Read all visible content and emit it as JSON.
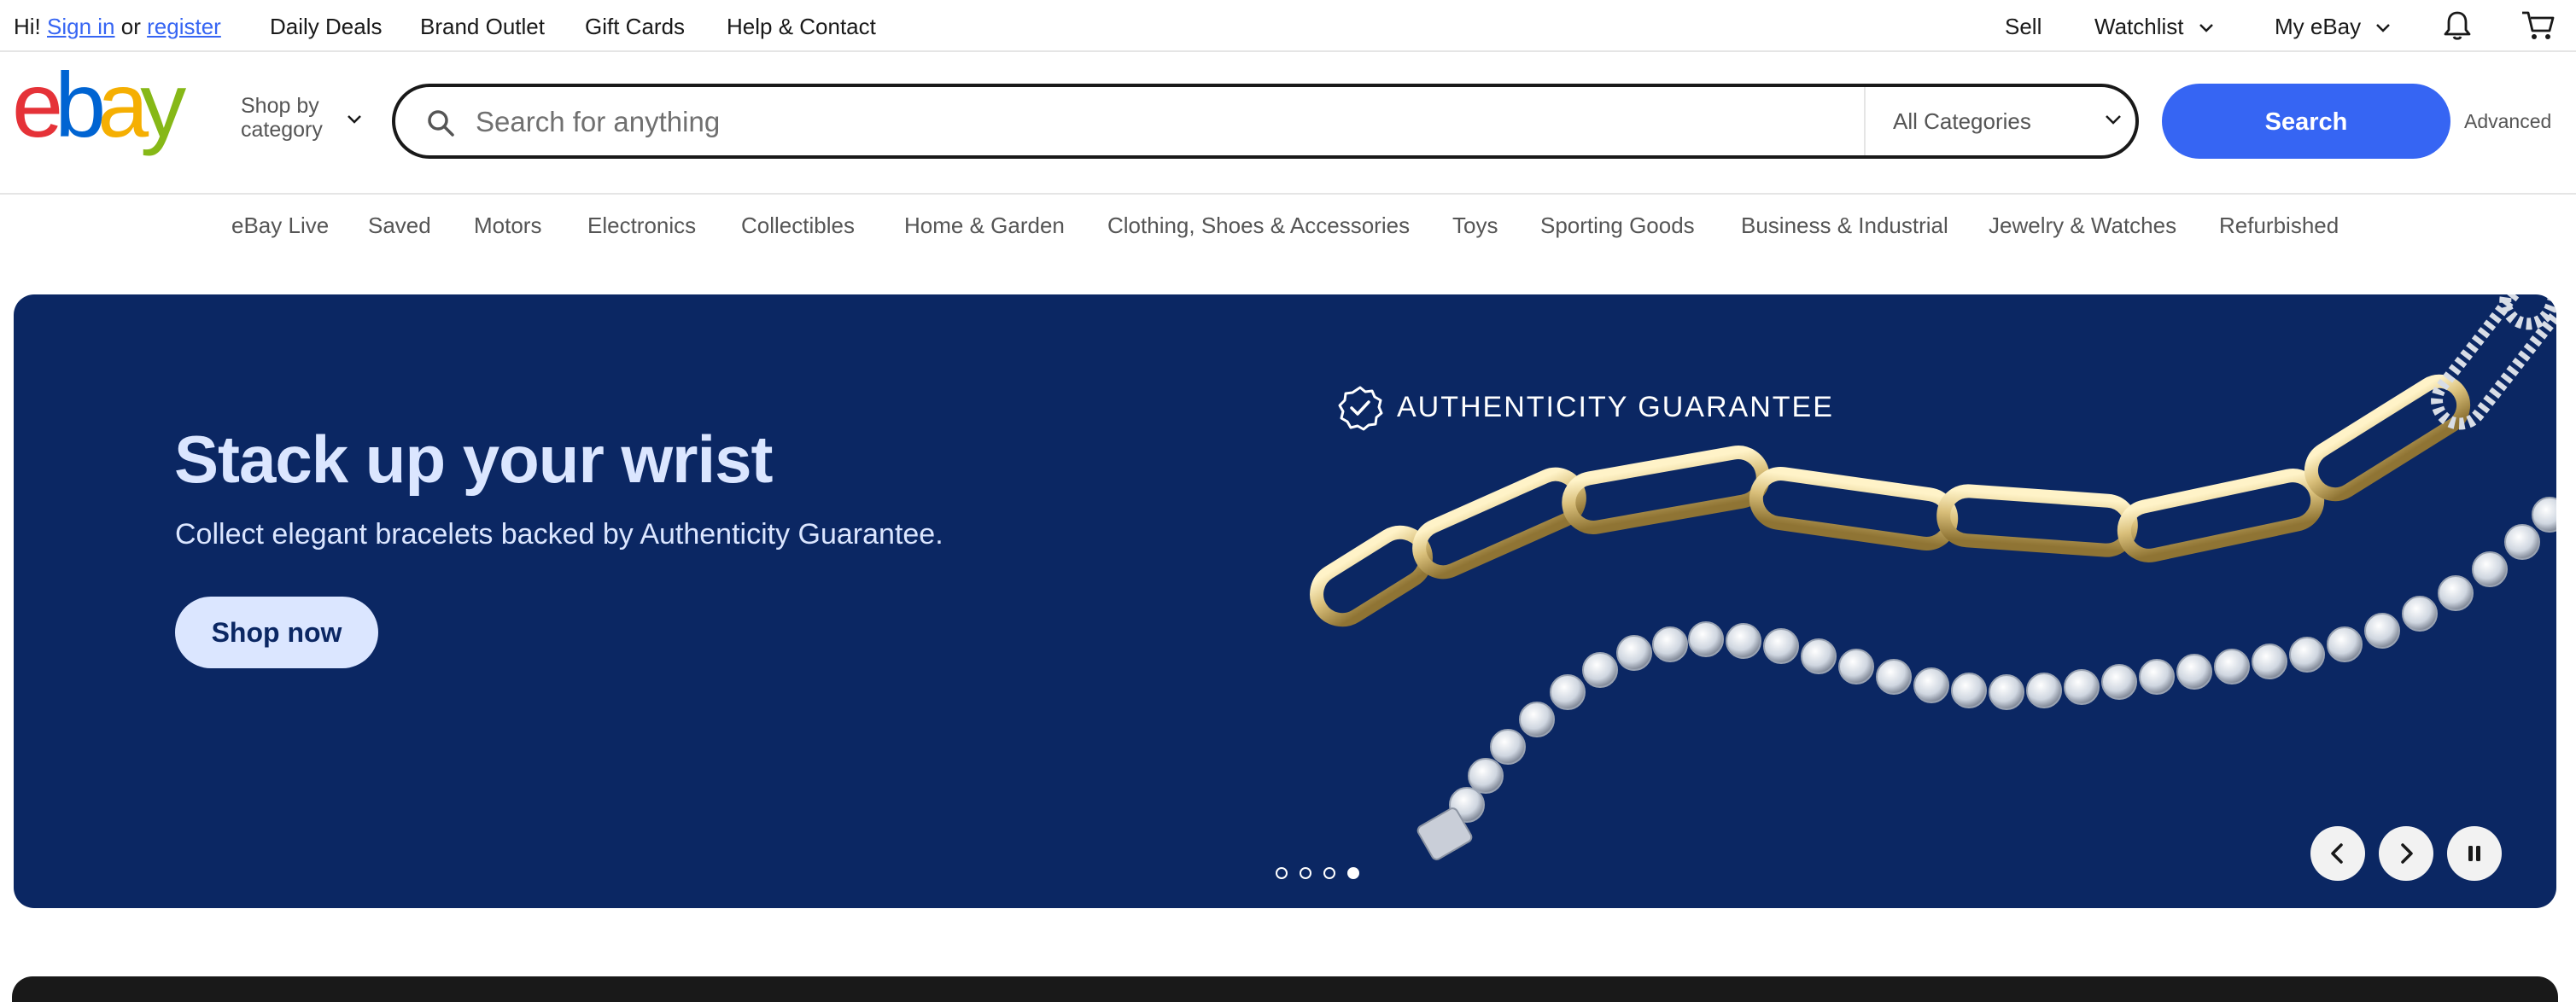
{
  "topbar": {
    "greeting": "Hi!",
    "sign_in": "Sign in",
    "or": "or",
    "register": "register",
    "links": [
      "Daily Deals",
      "Brand Outlet",
      "Gift Cards",
      "Help & Contact"
    ],
    "sell": "Sell",
    "watchlist": "Watchlist",
    "my_ebay": "My eBay",
    "icons": [
      "bell-icon",
      "cart-icon"
    ]
  },
  "header": {
    "logo_text": "ebay",
    "shop_by_line1": "Shop by",
    "shop_by_line2": "category",
    "search_placeholder": "Search for anything",
    "category_select": "All Categories",
    "search_button": "Search",
    "advanced": "Advanced"
  },
  "category_nav": [
    "eBay Live",
    "Saved",
    "Motors",
    "Electronics",
    "Collectibles",
    "Home & Garden",
    "Clothing, Shoes & Accessories",
    "Toys",
    "Sporting Goods",
    "Business & Industrial",
    "Jewelry & Watches",
    "Refurbished"
  ],
  "hero": {
    "title": "Stack up your wrist",
    "subtitle": "Collect elegant bracelets backed by Authenticity Guarantee.",
    "cta": "Shop now",
    "badge_text": "AUTHENTICITY GUARANTEE",
    "slide_count": 4,
    "active_slide": 4,
    "background_color": "#0b2763",
    "text_color": "#dbe6ff"
  },
  "colors": {
    "accent": "#3665f3",
    "logo_e": "#e53238",
    "logo_b": "#0064d2",
    "logo_a": "#f5af02",
    "logo_y": "#86b817"
  }
}
